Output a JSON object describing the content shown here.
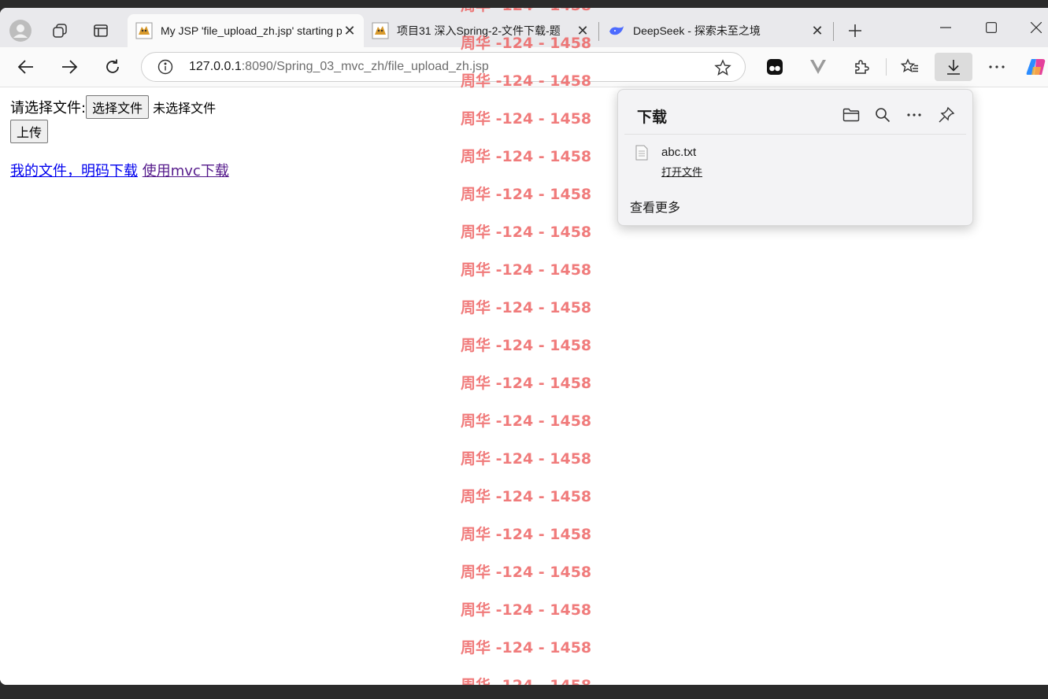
{
  "browser": {
    "tabs": [
      {
        "title": "My JSP 'file_upload_zh.jsp' starting page",
        "active": true
      },
      {
        "title": "项目31 深入Spring-2-文件下载-题",
        "active": false
      },
      {
        "title": "DeepSeek - 探索未至之境",
        "active": false
      }
    ],
    "url": {
      "host": "127.0.0.1",
      "rest": ":8090/Spring_03_mvc_zh/file_upload_zh.jsp"
    }
  },
  "page": {
    "file_label": "请选择文件:",
    "choose_button": "选择文件",
    "no_file_text": "未选择文件",
    "upload_button": "上传",
    "links": [
      {
        "text": "我的文件，明码下载"
      },
      {
        "text": "使用mvc下载"
      }
    ]
  },
  "downloads": {
    "title": "下载",
    "items": [
      {
        "filename": "abc.txt",
        "action": "打开文件"
      }
    ],
    "see_more": "查看更多"
  },
  "watermark": {
    "text": "周华 -124 - 1458",
    "color": "#ec5a5a"
  },
  "colors": {
    "link": "#0000ee",
    "visited_link": "#551a8b",
    "accent": "#0067c0"
  }
}
